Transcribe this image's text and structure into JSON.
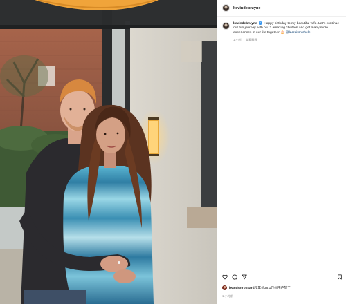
{
  "post": {
    "username": "kevindebruyne",
    "caption": {
      "username": "kevindebruyne",
      "verified_mark": "✓",
      "text": "Happy birthday to my beautiful wife. Let's continue our fun journey with our 3 amazing children and get many more experiences in our life together 🎂",
      "mention": "@lacroixmichele"
    },
    "caption_meta": {
      "age": "1 小时",
      "translate": "查看翻译"
    },
    "likes": {
      "liker": "leandrotrossard",
      "text": "和其他36.1万位用户赞了"
    },
    "timestamp": "1 小时前"
  },
  "icons": {
    "like": "heart-icon",
    "comment": "comment-icon",
    "share": "share-icon",
    "save": "bookmark-icon"
  },
  "colors": {
    "verified": "#3897f0",
    "mention": "#00376b",
    "muted": "#8e8e8e"
  }
}
